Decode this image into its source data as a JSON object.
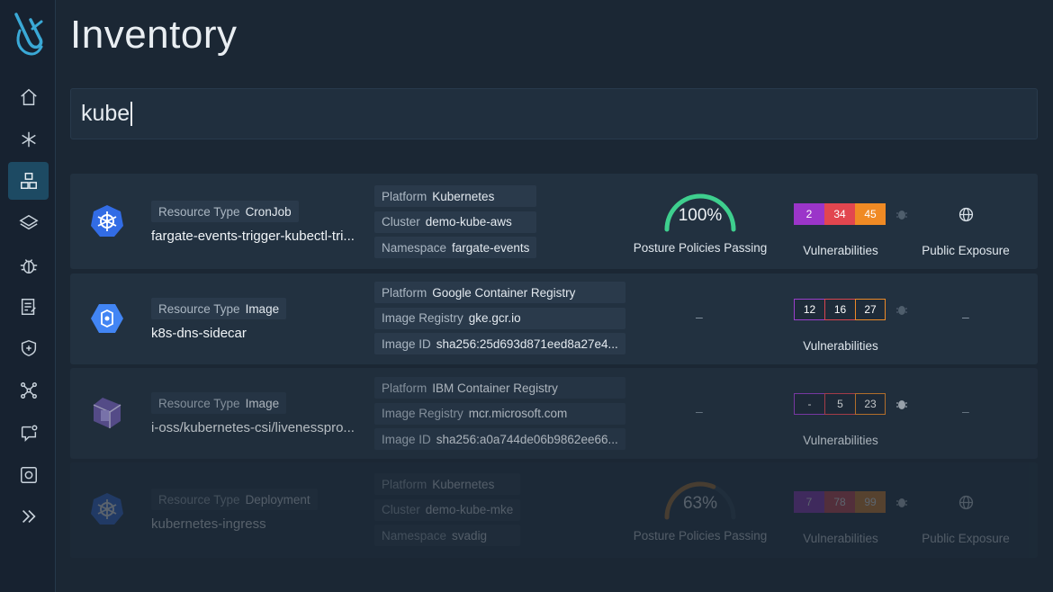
{
  "page": {
    "title": "Inventory"
  },
  "search": {
    "value": "kube"
  },
  "sidebar": {
    "items": [
      {
        "icon": "home-icon"
      },
      {
        "icon": "asterisk-icon"
      },
      {
        "icon": "inventory-icon",
        "active": true
      },
      {
        "icon": "layers-icon"
      },
      {
        "icon": "bug-icon"
      },
      {
        "icon": "report-icon"
      },
      {
        "icon": "shield-icon"
      },
      {
        "icon": "graph-icon"
      },
      {
        "icon": "chat-icon"
      },
      {
        "icon": "scan-icon"
      },
      {
        "icon": "expand-icon"
      }
    ]
  },
  "rows": [
    {
      "icon": "kubernetes-icon",
      "type_label": "Resource Type",
      "type_value": "CronJob",
      "name": "fargate-events-trigger-kubectl-tri...",
      "meta": [
        {
          "k": "Platform",
          "v": "Kubernetes"
        },
        {
          "k": "Cluster",
          "v": "demo-kube-aws"
        },
        {
          "k": "Namespace",
          "v": "fargate-events"
        }
      ],
      "posture": {
        "pct_text": "100%",
        "fraction": 1.0,
        "label": "Posture Policies Passing"
      },
      "vulns": {
        "c": "2",
        "h": "34",
        "m": "45",
        "label": "Vulnerabilities"
      },
      "exposure": {
        "label": "Public Exposure"
      }
    },
    {
      "icon": "gcr-icon",
      "type_label": "Resource Type",
      "type_value": "Image",
      "name": "k8s-dns-sidecar",
      "meta": [
        {
          "k": "Platform",
          "v": "Google Container Registry"
        },
        {
          "k": "Image Registry",
          "v": "gke.gcr.io"
        },
        {
          "k": "Image ID",
          "v": "sha256:25d693d871eed8a27e4..."
        }
      ],
      "posture_dash": "–",
      "vulns": {
        "c": "12",
        "h": "16",
        "m": "27",
        "label": "Vulnerabilities"
      },
      "exposure_dash": "–"
    },
    {
      "icon": "ibm-registry-icon",
      "type_label": "Resource Type",
      "type_value": "Image",
      "name": "i-oss/kubernetes-csi/livenesspro...",
      "meta": [
        {
          "k": "Platform",
          "v": "IBM Container Registry"
        },
        {
          "k": "Image Registry",
          "v": "mcr.microsoft.com"
        },
        {
          "k": "Image ID",
          "v": "sha256:a0a744de06b9862ee66..."
        }
      ],
      "posture_dash": "–",
      "vulns": {
        "c": "-",
        "h": "5",
        "m": "23",
        "label": "Vulnerabilities"
      },
      "exposure_dash": "–"
    },
    {
      "icon": "kubernetes-icon",
      "type_label": "Resource Type",
      "type_value": "Deployment",
      "name": "kubernetes-ingress",
      "meta": [
        {
          "k": "Platform",
          "v": "Kubernetes"
        },
        {
          "k": "Cluster",
          "v": "demo-kube-mke"
        },
        {
          "k": "Namespace",
          "v": "svadig"
        }
      ],
      "posture": {
        "pct_text": "63%",
        "fraction": 0.63,
        "label": "Posture Policies Passing"
      },
      "vulns": {
        "c": "7",
        "h": "78",
        "m": "99",
        "label": "Vulnerabilities"
      },
      "exposure": {
        "label": "Public Exposure"
      }
    }
  ],
  "colors": {
    "accent": "#1d4a63",
    "gauge_pass": "#3ecf8e",
    "gauge_partial": "#b8762a",
    "critical": "#9b35c9",
    "high": "#e2464f",
    "medium": "#f08a24"
  }
}
